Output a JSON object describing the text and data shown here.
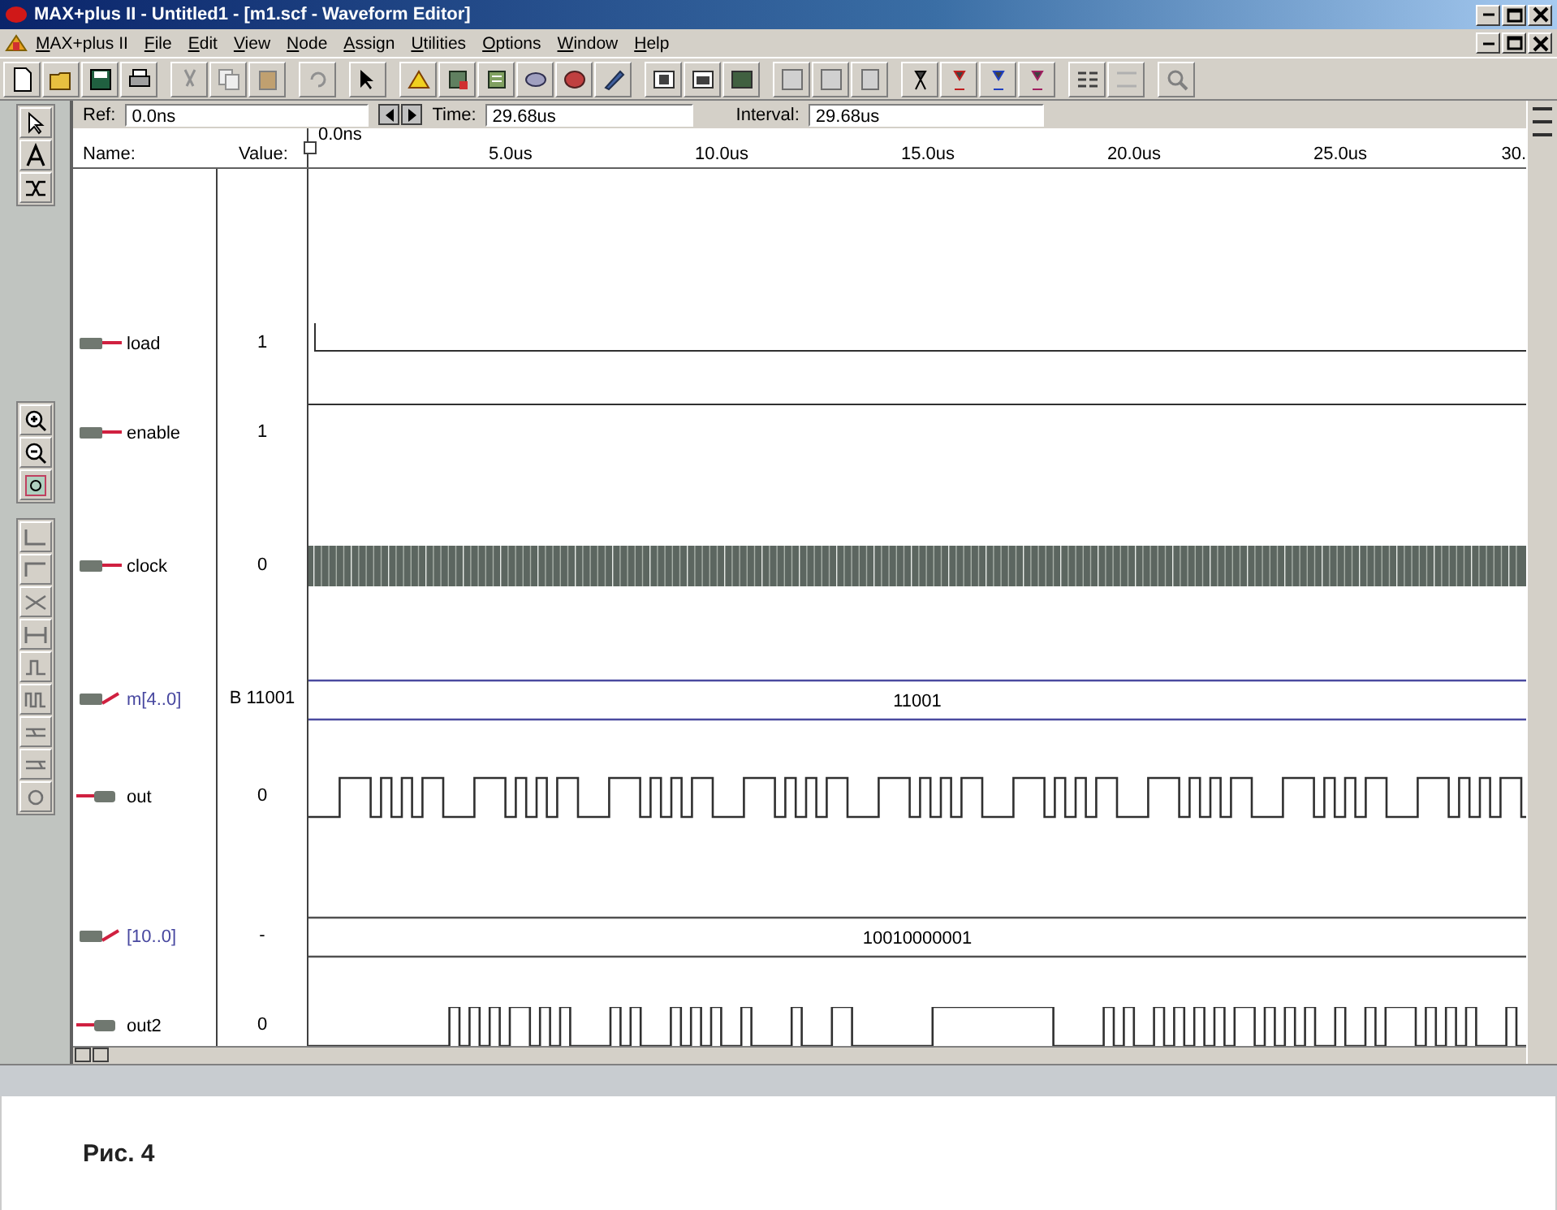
{
  "window": {
    "title": "MAX+plus II - Untitled1 - [m1.scf - Waveform Editor]"
  },
  "menu": [
    "MAX+plus II",
    "File",
    "Edit",
    "View",
    "Node",
    "Assign",
    "Utilities",
    "Options",
    "Window",
    "Help"
  ],
  "header": {
    "ref_label": "Ref:",
    "ref": "0.0ns",
    "time_label": "Time:",
    "time": "29.68us",
    "interval_label": "Interval:",
    "interval": "29.68us"
  },
  "ruler": {
    "start": "0.0ns",
    "ticks": [
      "5.0us",
      "10.0us",
      "15.0us",
      "20.0us",
      "25.0us",
      "30."
    ]
  },
  "columns": {
    "name": "Name:",
    "value": "Value:"
  },
  "signals": [
    {
      "name": "load",
      "value": "1",
      "kind": "input",
      "wave": {
        "kind": "pulse"
      }
    },
    {
      "name": "enable",
      "value": "1",
      "kind": "input",
      "wave": {
        "kind": "high"
      }
    },
    {
      "name": "clock",
      "value": "0",
      "kind": "input",
      "wave": {
        "kind": "clock"
      }
    },
    {
      "name": "m[4..0]",
      "value": "B 11001",
      "kind": "input",
      "wave": {
        "kind": "bus",
        "value": "11001"
      }
    },
    {
      "name": "out",
      "value": "0",
      "kind": "output",
      "wave": {
        "kind": "periodic"
      }
    },
    {
      "name": "[10..0]",
      "value": "-",
      "kind": "input",
      "wave": {
        "kind": "bus",
        "value": "10010000001"
      }
    },
    {
      "name": "out2",
      "value": "0",
      "kind": "output",
      "wave": {
        "kind": "irregular"
      }
    }
  ],
  "caption": "Рис. 4"
}
